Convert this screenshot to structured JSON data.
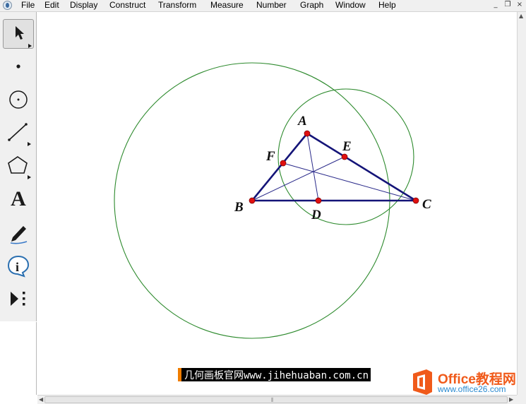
{
  "menubar": {
    "items": [
      "File",
      "Edit",
      "Display",
      "Construct",
      "Transform",
      "Measure",
      "Number",
      "Graph",
      "Window",
      "Help"
    ],
    "window_controls": [
      "_",
      "❐",
      "×"
    ]
  },
  "toolbox": {
    "tools": [
      {
        "name": "selection-arrow-tool",
        "active": true
      },
      {
        "name": "point-tool"
      },
      {
        "name": "compass-tool"
      },
      {
        "name": "straightedge-tool"
      },
      {
        "name": "polygon-tool"
      },
      {
        "name": "text-tool",
        "glyph": "A"
      },
      {
        "name": "marker-tool"
      },
      {
        "name": "information-tool"
      },
      {
        "name": "custom-tool"
      }
    ]
  },
  "sketch": {
    "points": {
      "A": "A",
      "B": "B",
      "C": "C",
      "D": "D",
      "E": "E",
      "F": "F"
    },
    "colors": {
      "triangle": "#141478",
      "cevians": "#2a2a8a",
      "circles": "#2d8a2d",
      "points": "#e01010"
    }
  },
  "caption": {
    "text": "几何画板官网www.jihehuaban.com.cn"
  },
  "logo": {
    "title": "Office教程网",
    "url": "www.office26.com"
  }
}
